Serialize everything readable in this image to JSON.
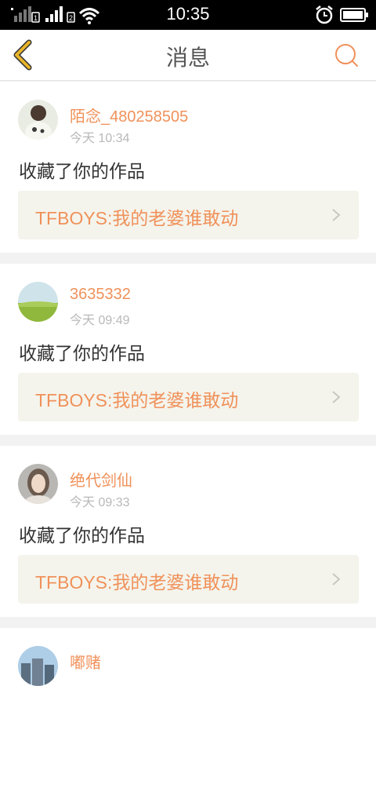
{
  "status_bar": {
    "time": "10:35"
  },
  "header": {
    "title": "消息"
  },
  "messages": [
    {
      "user": "陌念_480258505",
      "time": "今天 10:34",
      "action": "收藏了你的作品",
      "work_title": "TFBOYS:我的老婆谁敢动"
    },
    {
      "user": "3635332",
      "time": "今天 09:49",
      "action": "收藏了你的作品",
      "work_title": "TFBOYS:我的老婆谁敢动"
    },
    {
      "user": "绝代剑仙",
      "time": "今天 09:33",
      "action": "收藏了你的作品",
      "work_title": "TFBOYS:我的老婆谁敢动"
    },
    {
      "user": "嘟赌",
      "time": "",
      "action": "",
      "work_title": ""
    }
  ],
  "colors": {
    "accent": "#f0915a",
    "back_arrow": "#e8b42a",
    "work_bg": "#f4f4ec",
    "separator": "#f2f2f2"
  },
  "icons": {
    "back": "chevron-left-icon",
    "search": "search-icon",
    "chevron": "chevron-right-icon"
  }
}
